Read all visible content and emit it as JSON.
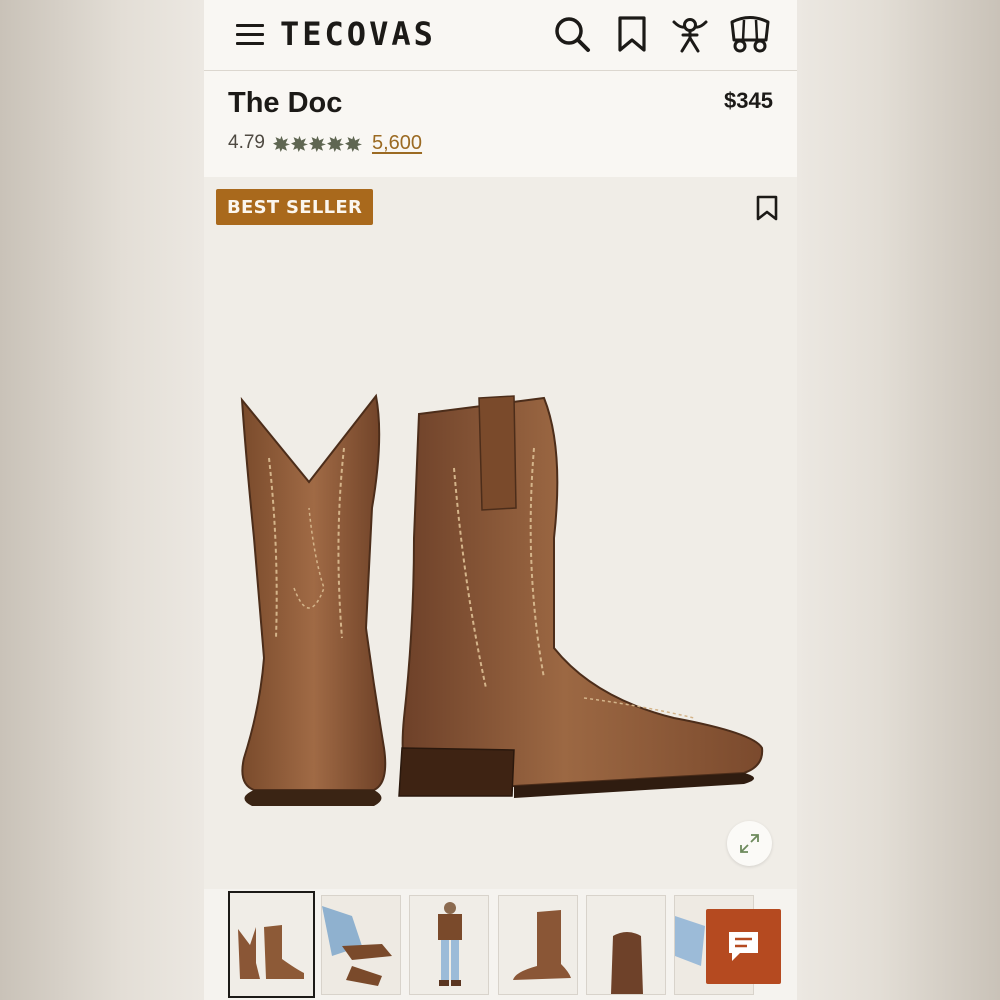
{
  "header": {
    "brand": "TECOVAS",
    "icons": [
      "menu-icon",
      "search-icon",
      "bookmark-icon",
      "account-icon",
      "cart-wagon-icon"
    ]
  },
  "product": {
    "title": "The Doc",
    "price": "$345",
    "rating": "4.79",
    "stars": 5,
    "review_count": "5,600",
    "badge": "BEST SELLER"
  },
  "gallery": {
    "thumbnails": [
      "boots pair",
      "seated leg view",
      "full-body model",
      "single boot side",
      "toe front view",
      "legs close-up"
    ],
    "selected_index": 0
  },
  "colors": {
    "badge": "#a9691c",
    "review_link": "#9b6a22",
    "chat_button": "#b54a20",
    "star": "#5f6652"
  }
}
